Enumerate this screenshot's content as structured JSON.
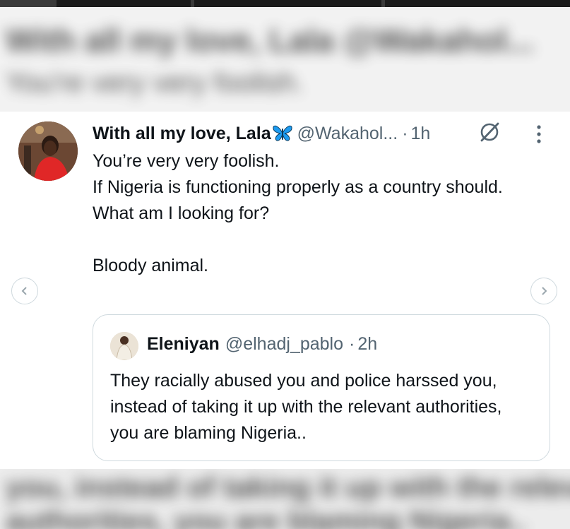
{
  "blurred_context": {
    "top_line_1": "With all my love, Lala @Wakahol...",
    "top_line_2": "You're very very foolish.",
    "bottom_line_1": "you, instead of taking it up with the relevant",
    "bottom_line_2": "authorities, you are blaming Nigeria.."
  },
  "tweet": {
    "display_name": "With all my love, Lala",
    "emoji_icon": "butterfly-emoji",
    "handle": "@Wakahol...",
    "separator": "·",
    "time": "1h",
    "lines": [
      "You’re very very foolish.",
      "If Nigeria is functioning properly as a country should.",
      "What am I looking for?",
      "",
      "Bloody animal."
    ]
  },
  "quoted_tweet": {
    "display_name": "Eleniyan",
    "handle": "@elhadj_pablo",
    "separator": "·",
    "time": "2h",
    "text": "They racially abused you and police harssed you, instead of taking it up with the relevant authorities, you are blaming Nigeria.."
  },
  "icons": {
    "grok": "grok-slash-circle-icon",
    "more": "more-vertical-icon",
    "prev": "chevron-left-icon",
    "next": "chevron-right-icon"
  },
  "colors": {
    "text_primary": "#0f1419",
    "text_secondary": "#536471",
    "border": "#cfd9de",
    "butterfly": "#1d9bf0"
  }
}
